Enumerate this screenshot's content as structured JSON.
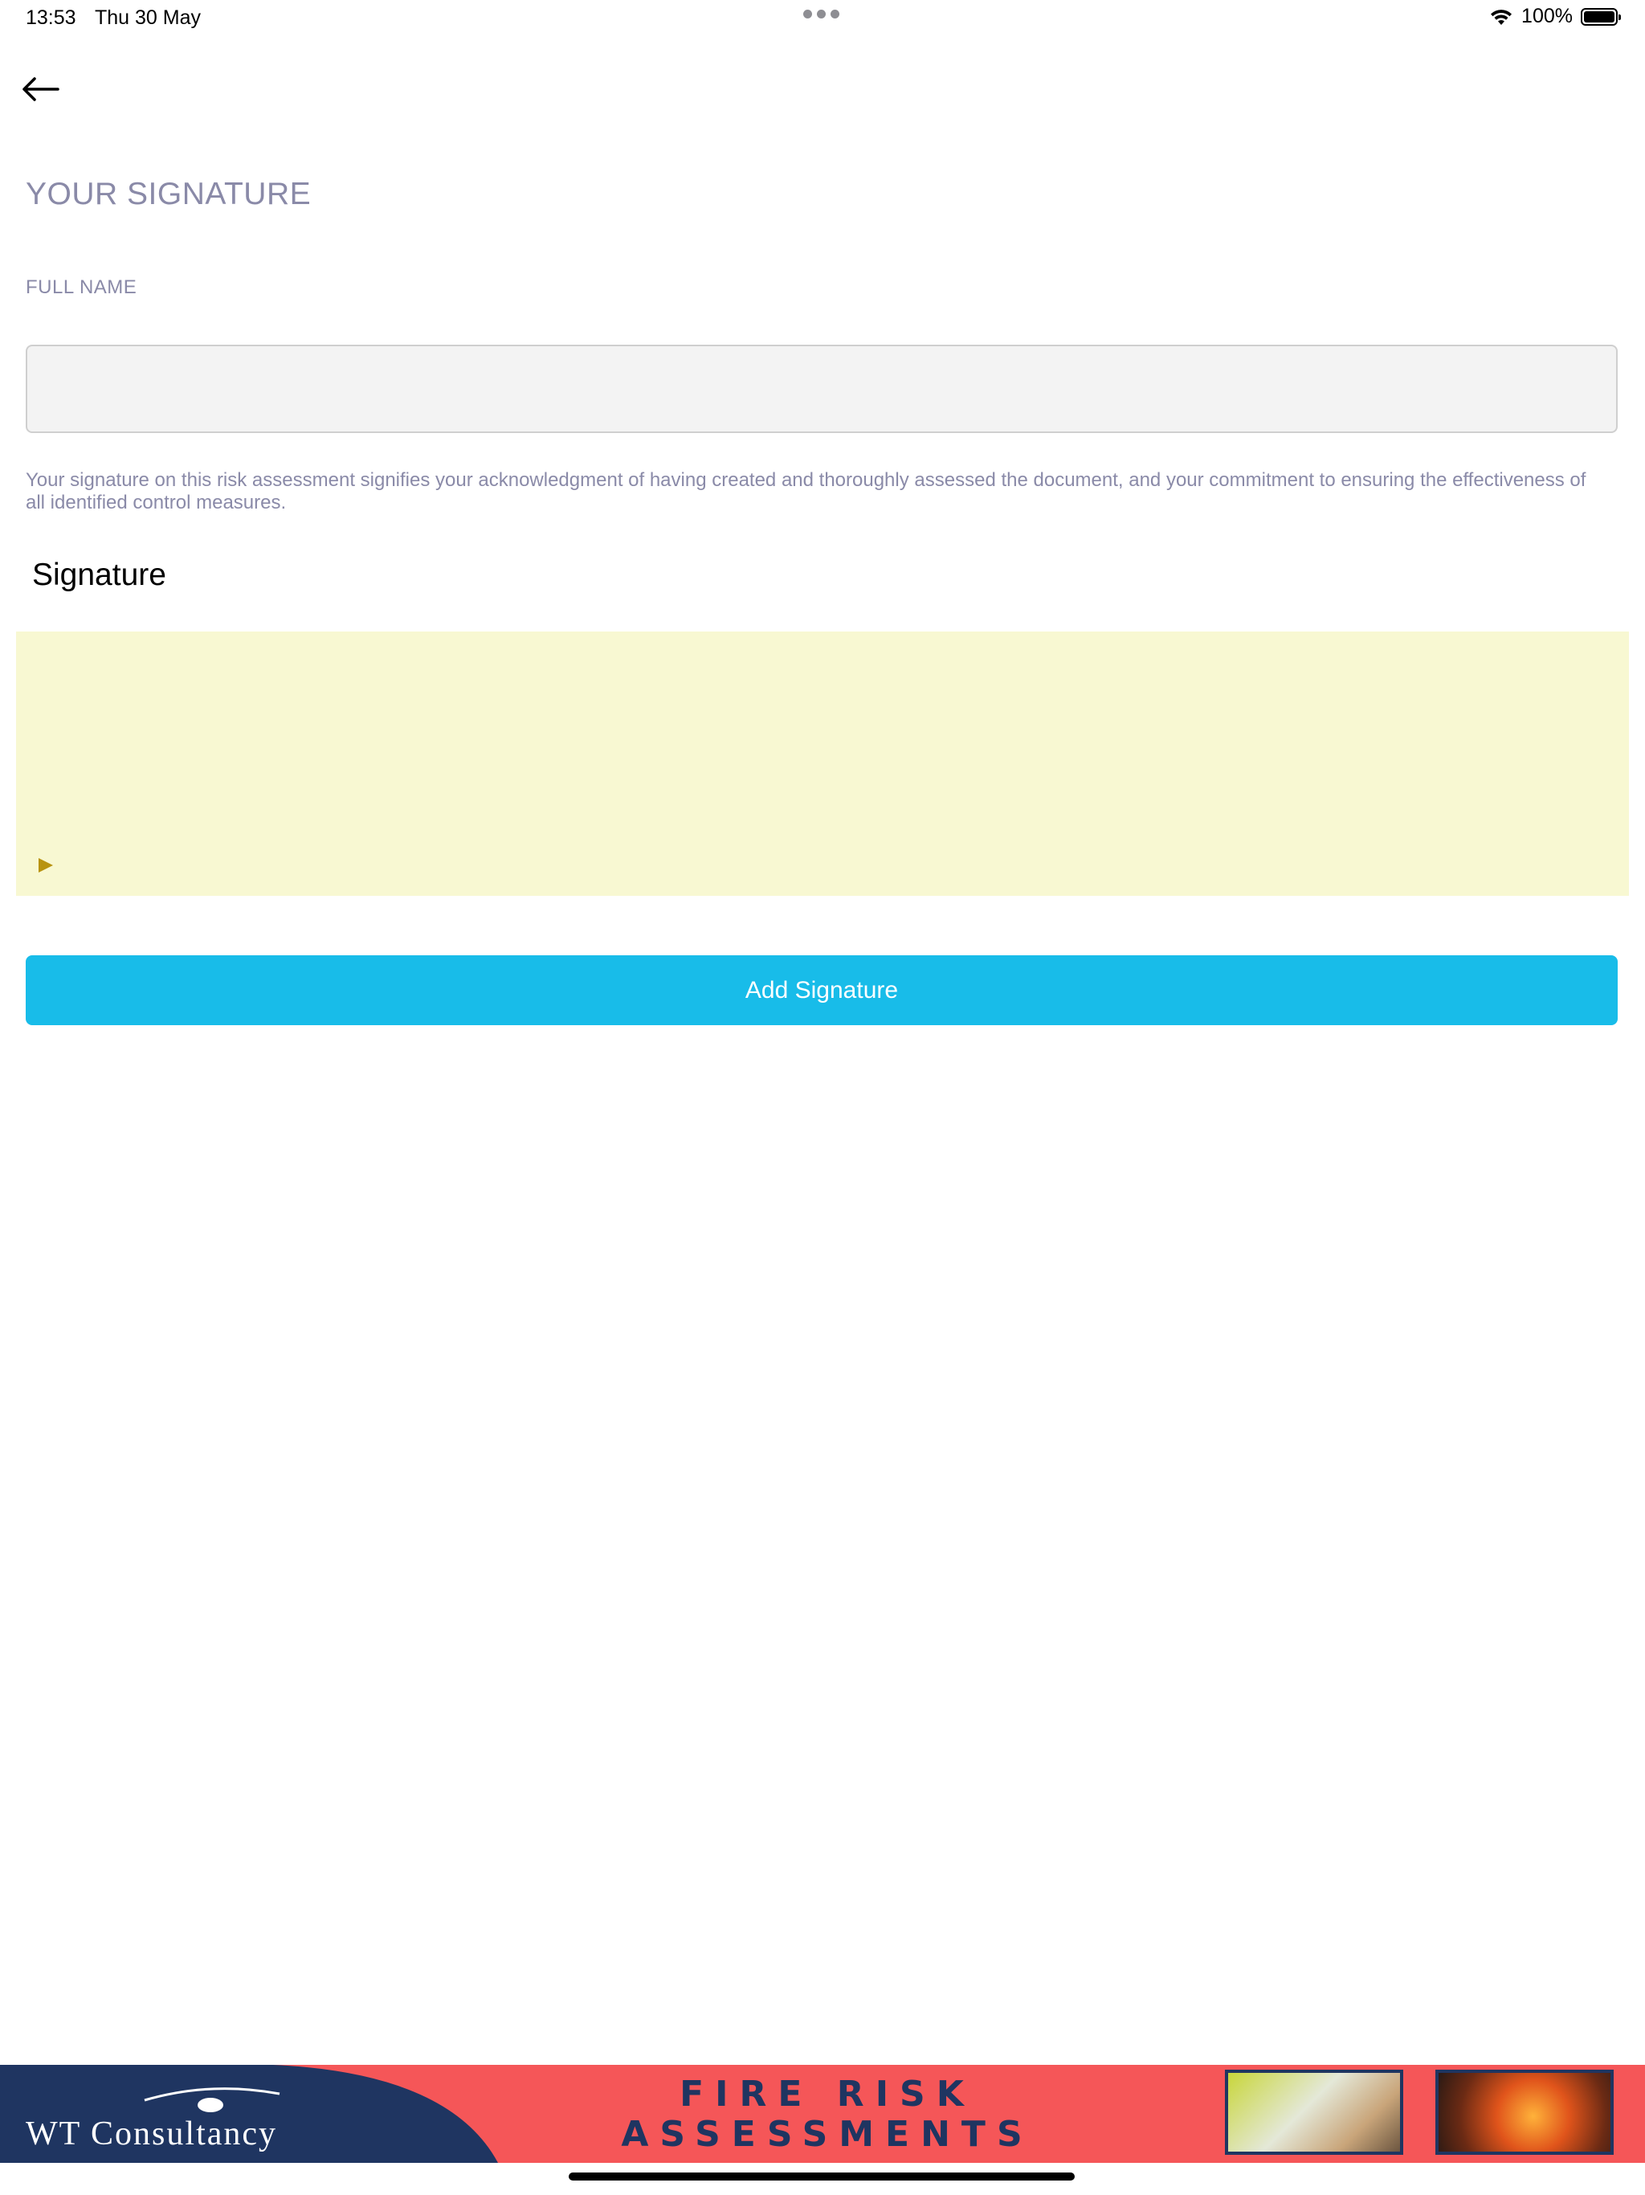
{
  "status_bar": {
    "time": "13:53",
    "date": "Thu 30 May",
    "battery_percent": "100%",
    "battery_level": 1.0,
    "icons": [
      "wifi-icon",
      "battery-icon"
    ]
  },
  "header": {
    "back_icon": "arrow-left-icon"
  },
  "page": {
    "title": "YOUR SIGNATURE",
    "full_name_label": "FULL NAME",
    "full_name_value": "",
    "description": "Your signature on this risk assessment signifies your acknowledgment of having created and thoroughly assessed the document, and your commitment to ensuring the effectiveness of all identified control measures.",
    "signature_heading": "Signature",
    "signature_pad_color": "#f8f8d2",
    "add_signature_label": "Add Signature",
    "accent_color": "#18bce9",
    "muted_text_color": "#8a8aa8"
  },
  "banner": {
    "logo_text": "WT Consultancy",
    "headline_line1": "FIRE RISK",
    "headline_line2": "ASSESSMENTS",
    "background_color": "#f55658",
    "logo_color": "#1f3561"
  }
}
